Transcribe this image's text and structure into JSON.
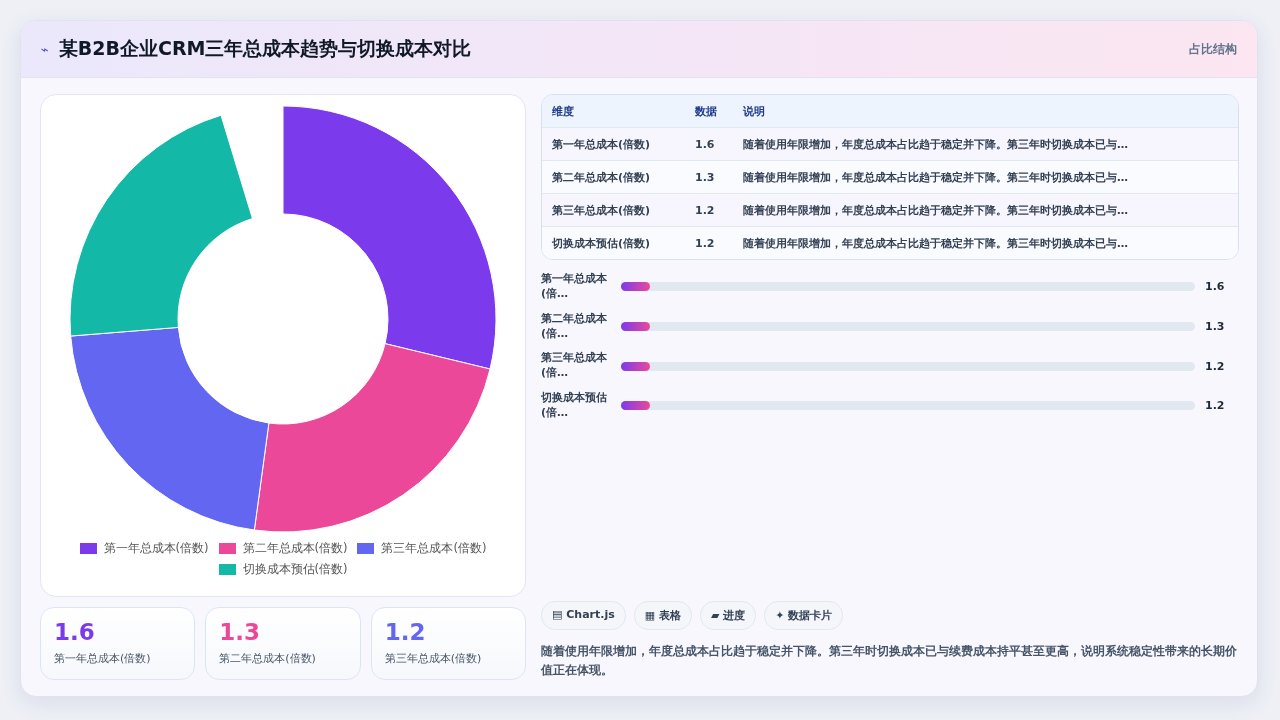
{
  "header": {
    "icon": "⌁",
    "title": "某B2B企业CRM三年总成本趋势与切换成本对比",
    "tag": "占比结构"
  },
  "chart": {
    "chart_data": {
      "type": "donut",
      "categories": [
        "第一年总成本(倍数)",
        "第二年总成本(倍数)",
        "第三年总成本(倍数)",
        "切换成本预估(倍数)"
      ],
      "series": [
        {
          "colors": [
            "#7c3aed",
            "#ec4899",
            "#6366f1",
            "#14b8a6"
          ],
          "values": [
            30.19,
            24.53,
            22.64,
            22.64
          ]
        }
      ]
    }
  },
  "stat_cards": [
    {
      "value": "1.6",
      "label": "第一年总成本(倍数)",
      "color": "#7c3aed"
    },
    {
      "value": "1.3",
      "label": "第二年总成本(倍数)",
      "color": "#ec4899"
    },
    {
      "value": "1.2",
      "label": "第三年总成本(倍数)",
      "color": "#6366f1"
    }
  ],
  "table": {
    "columns": [
      "维度",
      "数据",
      "说明"
    ],
    "rows": [
      [
        "第一年总成本(倍数)",
        "1.6",
        "随着使用年限增加，年度总成本占比趋于稳定并下降。第三年时切换成本已与…"
      ],
      [
        "第二年总成本(倍数)",
        "1.3",
        "随着使用年限增加，年度总成本占比趋于稳定并下降。第三年时切换成本已与…"
      ],
      [
        "第三年总成本(倍数)",
        "1.2",
        "随着使用年限增加，年度总成本占比趋于稳定并下降。第三年时切换成本已与…"
      ],
      [
        "切换成本预估(倍数)",
        "1.2",
        "随着使用年限增加，年度总成本占比趋于稳定并下降。第三年时切换成本已与…"
      ]
    ]
  },
  "bars": [
    {
      "label": "第一年总成本(倍…",
      "level": 0.05,
      "reading": "1.6"
    },
    {
      "label": "第二年总成本(倍…",
      "level": 0.05,
      "reading": "1.3"
    },
    {
      "label": "第三年总成本(倍…",
      "level": 0.05,
      "reading": "1.2"
    },
    {
      "label": "切换成本预估(倍…",
      "level": 0.05,
      "reading": "1.2"
    }
  ],
  "chips": [
    "▤ Chart.js",
    "▦ 表格",
    "▰ 进度",
    "✦ 数据卡片"
  ],
  "summary": "随着使用年限增加，年度总成本占比趋于稳定并下降。第三年时切换成本已与续费成本持平甚至更高，说明系统稳定性带来的长期价值正在体现。"
}
